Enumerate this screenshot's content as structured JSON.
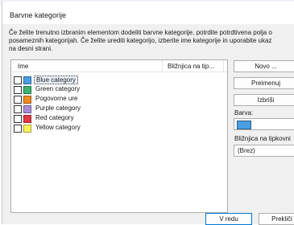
{
  "dialog": {
    "title": "Barvne kategorije",
    "description_lines": [
      "Če želite trenutno izbranim elementom dodeliti barvne kategorije, potrdite potrdtivena polja o",
      "posameznih kategorijah. Če želite urediti kategorijo, izberite ime kategorije in uporabite ukaz",
      "na desni strani."
    ]
  },
  "list": {
    "header_name": "Ime",
    "header_shortcut": "Bližnjica na tip...",
    "items": [
      {
        "label": "Blue category",
        "color": "#4a9ee3",
        "checked": false,
        "selected": true
      },
      {
        "label": "Green category",
        "color": "#3cb371",
        "checked": false,
        "selected": false
      },
      {
        "label": "Pogovorne ure",
        "color": "#f08a24",
        "checked": false,
        "selected": false
      },
      {
        "label": "Purple category",
        "color": "#a98cd9",
        "checked": false,
        "selected": false
      },
      {
        "label": "Red category",
        "color": "#e23a45",
        "checked": false,
        "selected": false
      },
      {
        "label": "Yellow category",
        "color": "#fff55a",
        "checked": false,
        "selected": false
      }
    ]
  },
  "side": {
    "new_button": "Novo ...",
    "rename_button": "Preimenuj",
    "delete_button": "Izbriši",
    "color_label": "Barva:",
    "selected_color": "#4a9ee3",
    "shortcut_label": "Bližnjica na tipkovni",
    "shortcut_value": "(Brez)"
  },
  "footer": {
    "ok_button": "V redu",
    "cancel_button": "Prekliči"
  }
}
